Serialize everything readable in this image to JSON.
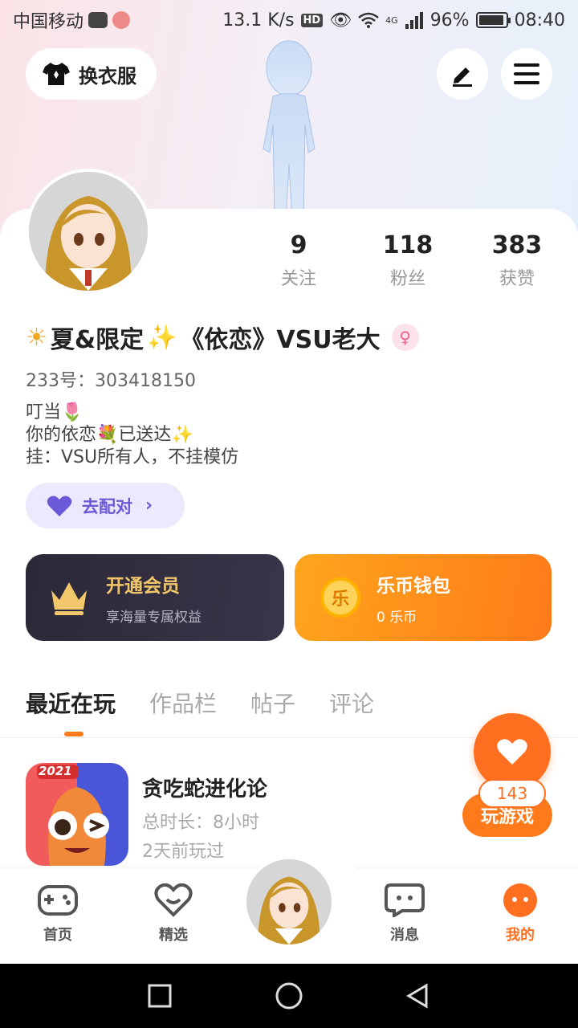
{
  "status_bar": {
    "carrier": "中国移动",
    "speed": "13.1 K/s",
    "hd": "HD",
    "network": "4G",
    "battery": "96%",
    "time": "08:40"
  },
  "header": {
    "dress_label": "换衣服",
    "edit_icon": "pen-icon",
    "menu_icon": "menu-icon"
  },
  "stats": [
    {
      "value": "9",
      "label": "关注"
    },
    {
      "value": "118",
      "label": "粉丝"
    },
    {
      "value": "383",
      "label": "获赞"
    }
  ],
  "profile": {
    "nickname": "夏&限定",
    "nickname_suffix": "《依恋》VSU老大",
    "gender": "female",
    "uid": "233号：303418150",
    "bio": [
      "叮当",
      "你的依恋",
      "已送达",
      "挂：VSU所有人，不挂模仿"
    ]
  },
  "match": {
    "label": "去配对"
  },
  "promos": {
    "vip": {
      "title": "开通会员",
      "subtitle": "享海量专属权益"
    },
    "wallet": {
      "title": "乐币钱包",
      "subtitle": "0 乐币",
      "coin": "乐"
    }
  },
  "tabs": [
    "最近在玩",
    "作品栏",
    "帖子",
    "评论"
  ],
  "game": {
    "badge": "2021",
    "name": "贪吃蛇进化论",
    "duration": "总时长：8小时",
    "last_played": "2天前玩过",
    "play_label": "玩游戏"
  },
  "fab": {
    "count": "143"
  },
  "bottom_nav": [
    {
      "label": "首页"
    },
    {
      "label": "精选"
    },
    {
      "label": "消息"
    },
    {
      "label": "我的"
    }
  ],
  "colors": {
    "accent": "#ff7a1a",
    "purple": "#6a5ad8",
    "gold": "#f2c76b"
  }
}
